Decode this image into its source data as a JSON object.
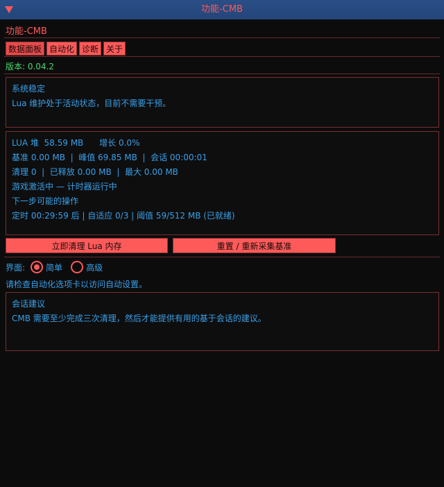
{
  "titlebar": {
    "title": "功能-CMB",
    "collapse_icon": "triangle-down-icon"
  },
  "window": {
    "title": "功能-CMB"
  },
  "tabs": [
    {
      "label": "数据面板",
      "active": true
    },
    {
      "label": "自动化",
      "active": false
    },
    {
      "label": "诊断",
      "active": false
    },
    {
      "label": "关于",
      "active": false
    }
  ],
  "version": "版本: 0.04.2",
  "status": {
    "title": "系统稳定",
    "message": "Lua 维护处于活动状态，目前不需要干预。"
  },
  "stats": {
    "lines": [
      "LUA 堆  58.59 MB      增长 0.0%",
      "基准 0.00 MB  |  峰值 69.85 MB  |  会话 00:00:01",
      "清理 0  |  已释放 0.00 MB  |  最大 0.00 MB",
      "游戏激活中 — 计时器运行中",
      "下一步可能的操作",
      "定时 00:29:59 后 | 自适应 0/3 | 阈值 59/512 MB (已就绪)"
    ]
  },
  "actions": {
    "clean_label": "立即清理 Lua 内存",
    "reset_label": "重置 / 重新采集基准"
  },
  "mode": {
    "label": "界面:",
    "options": [
      {
        "label": "简单",
        "selected": true
      },
      {
        "label": "高级",
        "selected": false
      }
    ]
  },
  "hint": "请检查自动化选项卡以访问自动设置。",
  "advice": {
    "title": "会话建议",
    "message": "CMB 需要至少完成三次清理，然后才能提供有用的基于会话的建议。"
  },
  "colors": {
    "accent": "#ff5a5a",
    "text": "#3aa0e8",
    "version": "#49d86e",
    "titlebar": "#23457a"
  }
}
